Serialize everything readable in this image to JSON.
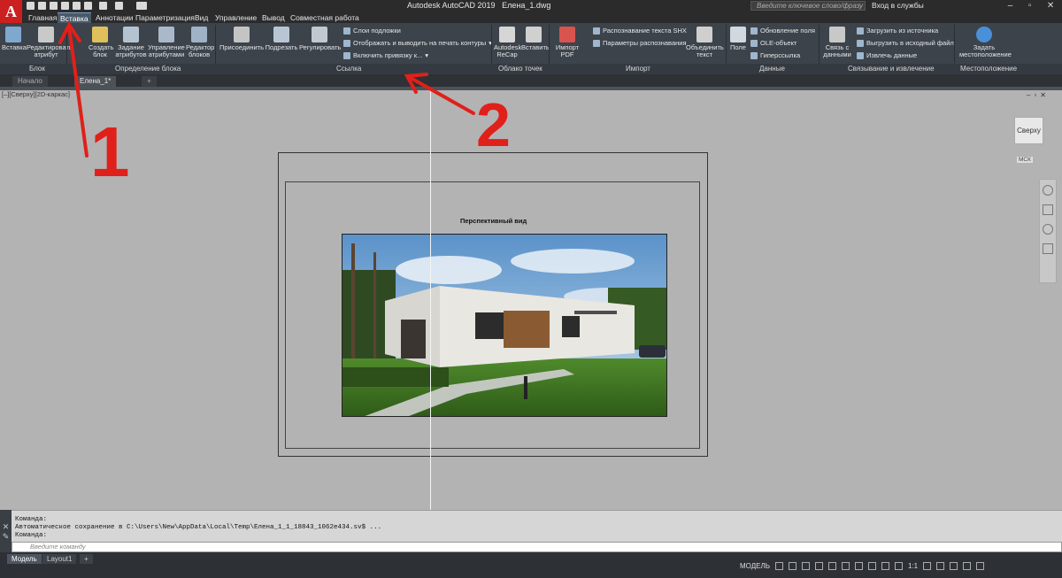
{
  "titlebar": {
    "app_title": "Autodesk AutoCAD 2019",
    "file_name": "Елена_1.dwg",
    "search_placeholder": "Введите ключевое слово/фразу",
    "login_label": "Вход в службы"
  },
  "app_logo": "A",
  "menu_tabs": [
    "Главная",
    "Вставка",
    "Аннотации",
    "Параметризация",
    "Вид",
    "Управление",
    "Вывод",
    "Совместная работа"
  ],
  "ribbon": {
    "block_panel": {
      "insert": "Вставка",
      "edit_attr": "Редактировать атрибут",
      "create_block": "Создать блок",
      "define_attr": "Задание атрибутов",
      "manage_attr": "Управление атрибутами",
      "block_editor": "Редактор блоков"
    },
    "ref_panel": {
      "attach": "Присоединить",
      "clip": "Подрезать",
      "adjust": "Регулировать",
      "underlay_layers": "Слои подложки",
      "frames": "Отображать и выводить на печать контуры",
      "snap": "Включить привязку к..."
    },
    "pointcloud_panel": {
      "recap": "Autodesk ReCap",
      "insert": "Вставить"
    },
    "import_panel": {
      "pdf": "Импорт PDF",
      "shx": "Распознавание текста SHX",
      "shx_params": "Параметры распознавания",
      "combine": "Объединить текст"
    },
    "data_panel": {
      "field": "Поле",
      "update_fields": "Обновление поля",
      "ole": "OLE-объект",
      "hyperlink": "Гиперссылка"
    },
    "link_panel": {
      "data_link": "Связь с данными",
      "download": "Загрузить из источника",
      "upload": "Выгрузить в исходный файл",
      "extract": "Извлечь данные"
    },
    "location_panel": {
      "set_location": "Задать местоположение"
    },
    "panel_labels": {
      "block": "Блок",
      "block_def": "Определение блока",
      "reference": "Ссылка",
      "pointcloud": "Облако точек",
      "import": "Импорт",
      "data": "Данные",
      "linking": "Связывание и извлечение",
      "location": "Местоположение"
    }
  },
  "file_tabs": [
    "Начало",
    "Елена_1*"
  ],
  "viewport": {
    "label": "[–][Сверху][2D-каркас]",
    "view_title": "Перспективный вид",
    "viewcube_label": "Сверху",
    "ucs_label": "МСК"
  },
  "annotations": {
    "one": "1",
    "two": "2",
    "color": "#e0201a"
  },
  "command": {
    "line1": "Команда:",
    "line2": "Автоматическое сохранение в C:\\Users\\New\\AppData\\Local\\Temp\\Елена_1_1_18843_1062e434.sv$ ...",
    "line3": "Команда:",
    "placeholder": "Введите команду"
  },
  "status": {
    "tabs": [
      "Модель",
      "Layout1"
    ],
    "model_label": "МОДЕЛЬ",
    "scale": "1:1"
  },
  "colors": {
    "accent": "#cc1f1f",
    "ribbon_bg": "#3c434b",
    "viewport_bg": "#b3b3b3"
  }
}
